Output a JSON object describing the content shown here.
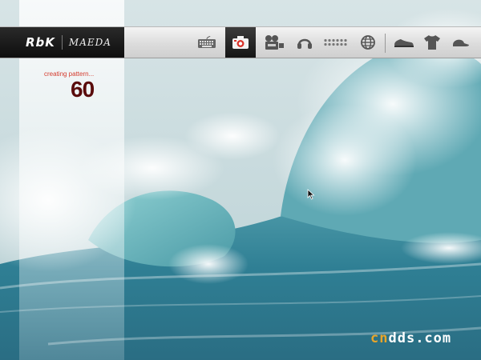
{
  "toolbar": {
    "brand_primary": "RbK",
    "brand_secondary": "MAEDA",
    "tools": [
      {
        "name": "keyboard-icon",
        "active": false
      },
      {
        "name": "camera-icon",
        "active": true
      },
      {
        "name": "video-camera-icon",
        "active": false
      },
      {
        "name": "headphones-icon",
        "active": false
      },
      {
        "name": "dots-pattern-icon",
        "active": false
      },
      {
        "name": "globe-icon",
        "active": false
      },
      {
        "name": "shoe-icon",
        "active": false
      },
      {
        "name": "tshirt-icon",
        "active": false
      },
      {
        "name": "cap-icon",
        "active": false
      }
    ]
  },
  "status": {
    "message": "creating pattern...",
    "count": "60"
  },
  "watermark": {
    "part1": "cn",
    "part2": "dds.com"
  },
  "colors": {
    "status_text": "#d43b2e",
    "counter": "#5a0c0c",
    "watermark_accent": "#e8a52a"
  }
}
